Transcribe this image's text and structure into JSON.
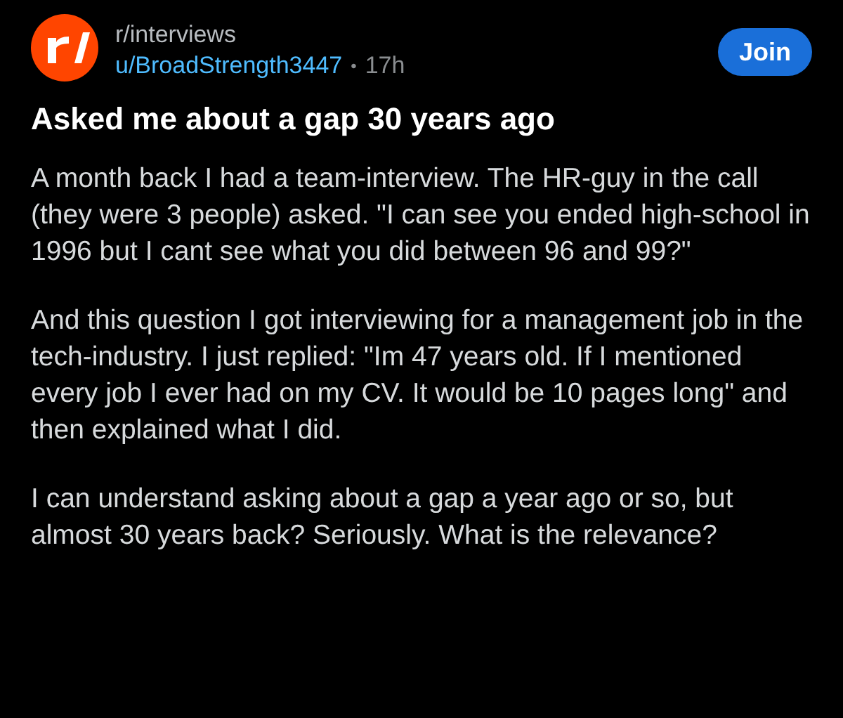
{
  "post": {
    "subreddit": "r/interviews",
    "author": "u/BroadStrength3447",
    "separator": "•",
    "age": "17h",
    "join_button": "Join",
    "title": "Asked me about a gap 30 years ago",
    "paragraphs": [
      "A month back I had a team-interview. The HR-guy in the call (they were 3 people) asked. \"I can see you ended high-school in 1996 but I cant see what you did between 96 and 99?\"",
      "And this question I got interviewing for a management job in the tech-industry. I just replied: \"Im 47 years old. If I mentioned every job I ever had on my CV. It would be 10 pages long\" and then explained what I did.",
      "I can understand asking about a gap a year ago or so, but almost 30 years back? Seriously. What is the relevance?"
    ]
  }
}
